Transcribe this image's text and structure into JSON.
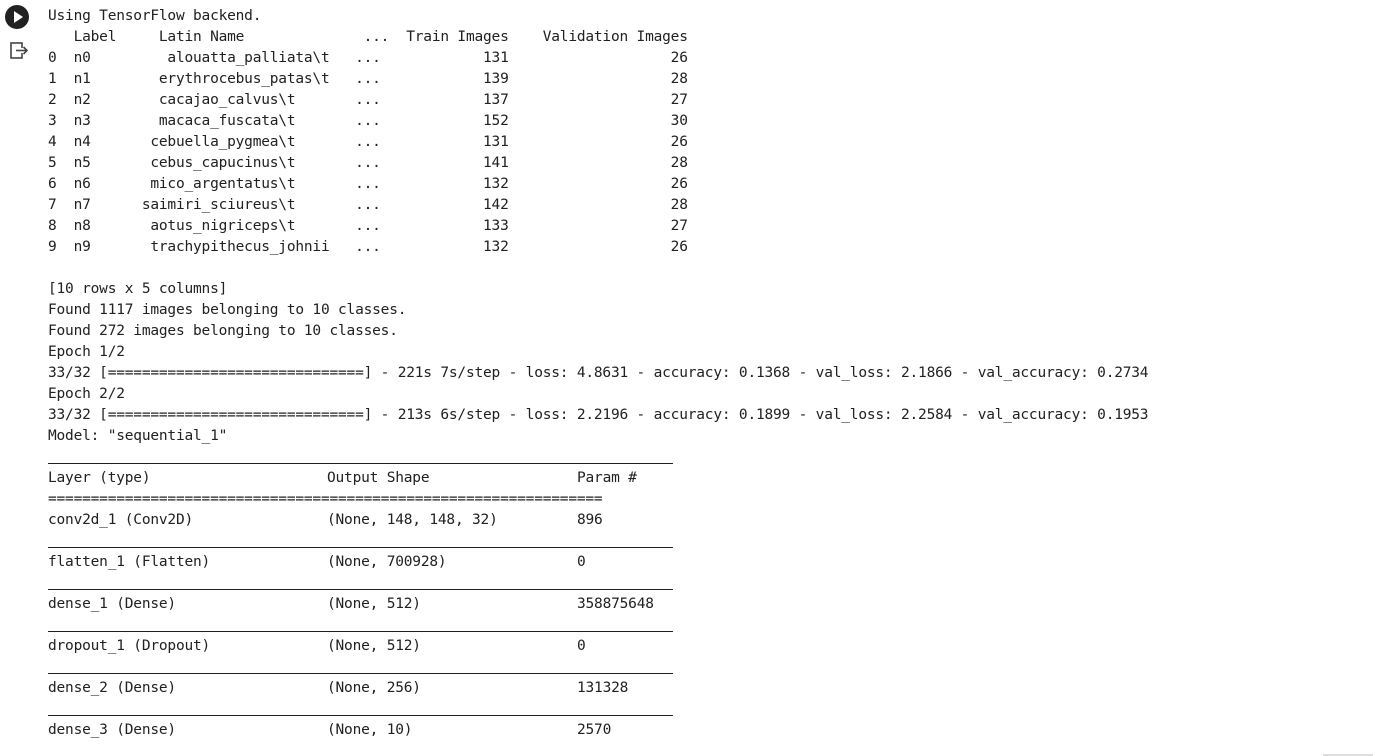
{
  "cell": {
    "run_icon": "play-icon",
    "output_icon": "output-redirect-icon"
  },
  "output": {
    "line_backend": "Using TensorFlow backend.",
    "dataframe_lines": [
      "   Label     Latin Name              ...  Train Images    Validation Images",
      "0  n0         alouatta_palliata\\t   ...            131                   26",
      "1  n1        erythrocebus_patas\\t   ...            139                   28",
      "2  n2        cacajao_calvus\\t       ...            137                   27",
      "3  n3        macaca_fuscata\\t       ...            152                   30",
      "4  n4       cebuella_pygmea\\t       ...            131                   26",
      "5  n5       cebus_capucinus\\t       ...            141                   28",
      "6  n6       mico_argentatus\\t       ...            132                   26",
      "7  n7      saimiri_sciureus\\t       ...            142                   28",
      "8  n8       aotus_nigriceps\\t       ...            133                   27",
      "9  n9       trachypithecus_johnii   ...            132                   26"
    ],
    "training_lines": [
      "[10 rows x 5 columns]",
      "Found 1117 images belonging to 10 classes.",
      "Found 272 images belonging to 10 classes.",
      "Epoch 1/2",
      "33/32 [==============================] - 221s 7s/step - loss: 4.8631 - accuracy: 0.1368 - val_loss: 2.1866 - val_accuracy: 0.2734",
      "Epoch 2/2",
      "33/32 [==============================] - 213s 6s/step - loss: 2.2196 - accuracy: 0.1899 - val_loss: 2.2584 - val_accuracy: 0.1953",
      "Model: \"sequential_1\""
    ],
    "summary": {
      "header": [
        "Layer (type)",
        "Output Shape",
        "Param #"
      ],
      "double_rule": "=================================================================",
      "layers": [
        {
          "layer": "conv2d_1 (Conv2D)",
          "shape": "(None, 148, 148, 32)",
          "params": "896"
        },
        {
          "layer": "flatten_1 (Flatten)",
          "shape": "(None, 700928)",
          "params": "0"
        },
        {
          "layer": "dense_1 (Dense)",
          "shape": "(None, 512)",
          "params": "358875648"
        },
        {
          "layer": "dropout_1 (Dropout)",
          "shape": "(None, 512)",
          "params": "0"
        },
        {
          "layer": "dense_2 (Dense)",
          "shape": "(None, 256)",
          "params": "131328"
        },
        {
          "layer": "dense_3 (Dense)",
          "shape": "(None, 10)",
          "params": "2570"
        }
      ]
    }
  }
}
